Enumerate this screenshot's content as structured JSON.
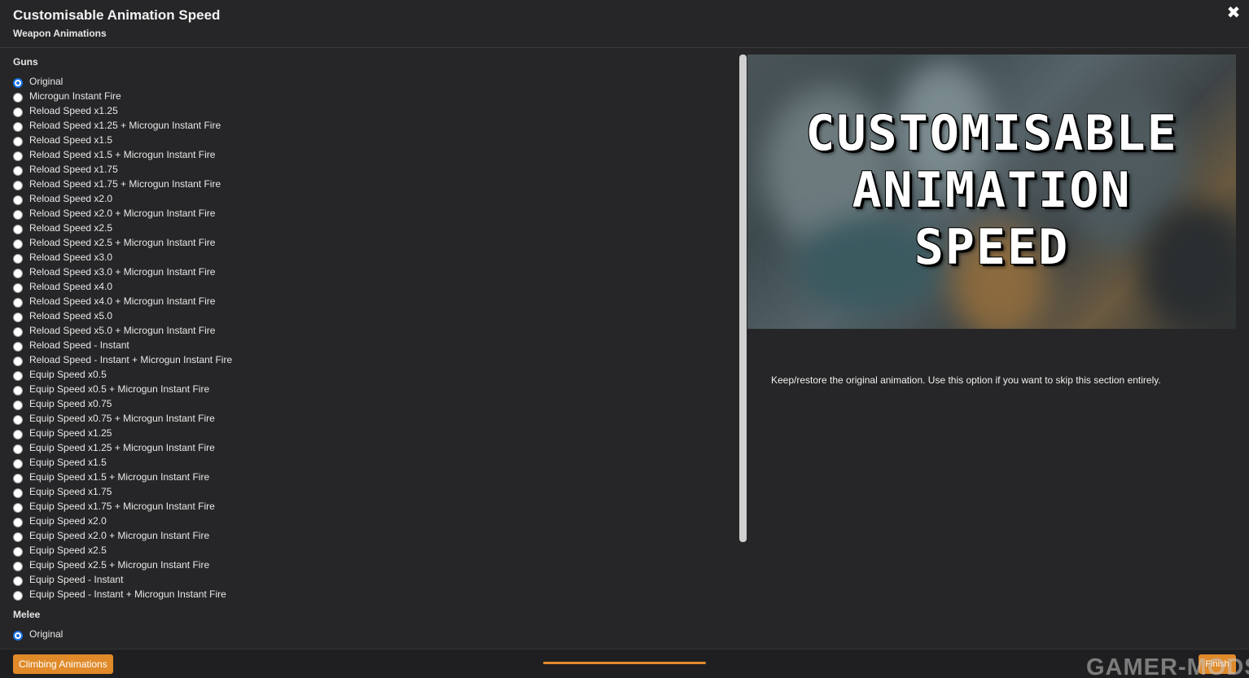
{
  "header": {
    "title": "Customisable Animation Speed",
    "subtitle": "Weapon Animations",
    "close_icon": "✖"
  },
  "groups": [
    {
      "label": "Guns",
      "options": [
        {
          "label": "Original",
          "checked": true
        },
        {
          "label": "Microgun Instant Fire"
        },
        {
          "label": "Reload Speed x1.25"
        },
        {
          "label": "Reload Speed x1.25 + Microgun Instant Fire"
        },
        {
          "label": "Reload Speed x1.5"
        },
        {
          "label": "Reload Speed x1.5 + Microgun Instant Fire"
        },
        {
          "label": "Reload Speed x1.75"
        },
        {
          "label": "Reload Speed x1.75 + Microgun Instant Fire"
        },
        {
          "label": "Reload Speed x2.0"
        },
        {
          "label": "Reload Speed x2.0 + Microgun Instant Fire"
        },
        {
          "label": "Reload Speed x2.5"
        },
        {
          "label": "Reload Speed x2.5 + Microgun Instant Fire"
        },
        {
          "label": "Reload Speed x3.0"
        },
        {
          "label": "Reload Speed x3.0 + Microgun Instant Fire"
        },
        {
          "label": "Reload Speed x4.0"
        },
        {
          "label": "Reload Speed x4.0 + Microgun Instant Fire"
        },
        {
          "label": "Reload Speed x5.0"
        },
        {
          "label": "Reload Speed x5.0 + Microgun Instant Fire"
        },
        {
          "label": "Reload Speed - Instant"
        },
        {
          "label": "Reload Speed - Instant + Microgun Instant Fire"
        },
        {
          "label": "Equip Speed x0.5"
        },
        {
          "label": "Equip Speed x0.5 + Microgun Instant Fire"
        },
        {
          "label": "Equip Speed x0.75"
        },
        {
          "label": "Equip Speed x0.75 + Microgun Instant Fire"
        },
        {
          "label": "Equip Speed x1.25"
        },
        {
          "label": "Equip Speed x1.25 + Microgun Instant Fire"
        },
        {
          "label": "Equip Speed x1.5"
        },
        {
          "label": "Equip Speed x1.5 + Microgun Instant Fire"
        },
        {
          "label": "Equip Speed x1.75"
        },
        {
          "label": "Equip Speed x1.75 + Microgun Instant Fire"
        },
        {
          "label": "Equip Speed x2.0"
        },
        {
          "label": "Equip Speed x2.0 + Microgun Instant Fire"
        },
        {
          "label": "Equip Speed x2.5"
        },
        {
          "label": "Equip Speed x2.5 + Microgun Instant Fire"
        },
        {
          "label": "Equip Speed - Instant"
        },
        {
          "label": "Equip Speed - Instant + Microgun Instant Fire"
        }
      ]
    },
    {
      "label": "Melee",
      "options": [
        {
          "label": "Original",
          "checked": true
        }
      ]
    }
  ],
  "preview": {
    "line1": "CUSTOMISABLE",
    "line2": "ANIMATION",
    "line3": "SPEED"
  },
  "description": "Keep/restore the original animation. Use this option if you want to skip this section entirely.",
  "footer": {
    "back_label": "Climbing Animations",
    "next_label": "Finish",
    "watermark": "GAMER-MODS"
  },
  "colors": {
    "accent": "#e08a2a",
    "radio_selected": "#1a73e8",
    "background": "#262628"
  }
}
